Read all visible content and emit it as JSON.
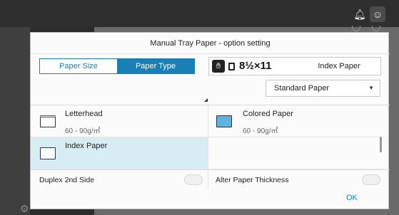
{
  "topbar": {
    "icons": [
      "bell-icon",
      "user-icon"
    ]
  },
  "dialog": {
    "title": "Manual Tray Paper - option setting",
    "tabs": [
      {
        "label": "Paper Size",
        "active": false
      },
      {
        "label": "Paper Type",
        "active": true
      }
    ],
    "indicator": {
      "size": "8½×11",
      "type": "Index Paper"
    },
    "select": {
      "value": "Standard Paper"
    },
    "paper_types": [
      {
        "name": "Letterhead",
        "weight": "60 - 90g/㎡",
        "icon": "letterhead-icon"
      },
      {
        "name": "Colored Paper",
        "weight": "60 - 90g/㎡",
        "icon": "colored-paper-icon"
      },
      {
        "name": "Index Paper",
        "weight": "",
        "icon": "index-paper-icon",
        "selected": true
      }
    ],
    "options": {
      "duplex": "Duplex 2nd Side",
      "alter": "Alter Paper Thickness"
    },
    "ok": "OK"
  },
  "colors": {
    "accent": "#1a7fb5",
    "selected_row": "#d8ecf4"
  }
}
